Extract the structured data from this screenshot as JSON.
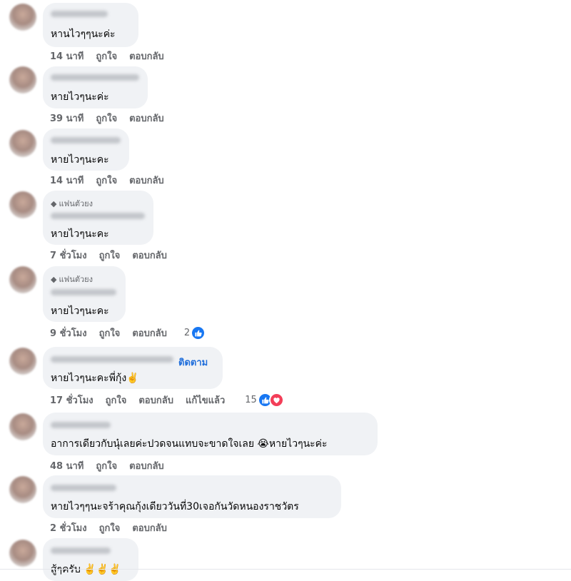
{
  "colors": {
    "bubble": "#f0f2f5",
    "action_text": "#65676b",
    "follow_blue": "#216fdb",
    "like_blue": "#1877f2",
    "love_red": "#f33e58"
  },
  "comments": [
    {
      "text": "หานไวๆๆนะค่ะ",
      "time": "14 นาที",
      "like": "ถูกใจ",
      "reply": "ตอบกลับ"
    },
    {
      "text": "หายไวๆนะค่ะ",
      "time": "39 นาที",
      "like": "ถูกใจ",
      "reply": "ตอบกลับ"
    },
    {
      "text": "หายไวๆนะคะ",
      "time": "14 นาที",
      "like": "ถูกใจ",
      "reply": "ตอบกลับ"
    },
    {
      "badge": "แฟนตัวยง",
      "text": "หายไวๆนะคะ",
      "time": "7 ชั่วโมง",
      "like": "ถูกใจ",
      "reply": "ตอบกลับ"
    },
    {
      "badge": "แฟนตัวยง",
      "text": "หายไวๆนะคะ",
      "time": "9 ชั่วโมง",
      "like": "ถูกใจ",
      "reply": "ตอบกลับ",
      "reactions": "2"
    },
    {
      "follow": "ติดตาม",
      "text": "หายไวๆนะคะพี่กุ้ง✌️",
      "time": "17 ชั่วโมง",
      "like": "ถูกใจ",
      "reply": "ตอบกลับ",
      "edited": "แก้ไขแล้ว",
      "reactions": "15"
    },
    {
      "text": "อาการเดียวกับนุ๋เลยค่ะปวดจนแทบจะขาดใจเลย 😭หายไวๆนะค่ะ",
      "time": "48 นาที",
      "like": "ถูกใจ",
      "reply": "ตอบกลับ"
    },
    {
      "text": "หายไวๆๆนะจร้าคุณกุ้งเดียววันที่30เจอกันวัดหนองราชวัตร",
      "time": "2 ชั่วโมง",
      "like": "ถูกใจ",
      "reply": "ตอบกลับ"
    },
    {
      "text": "สู้ๆครับ ✌️✌️✌️"
    }
  ]
}
